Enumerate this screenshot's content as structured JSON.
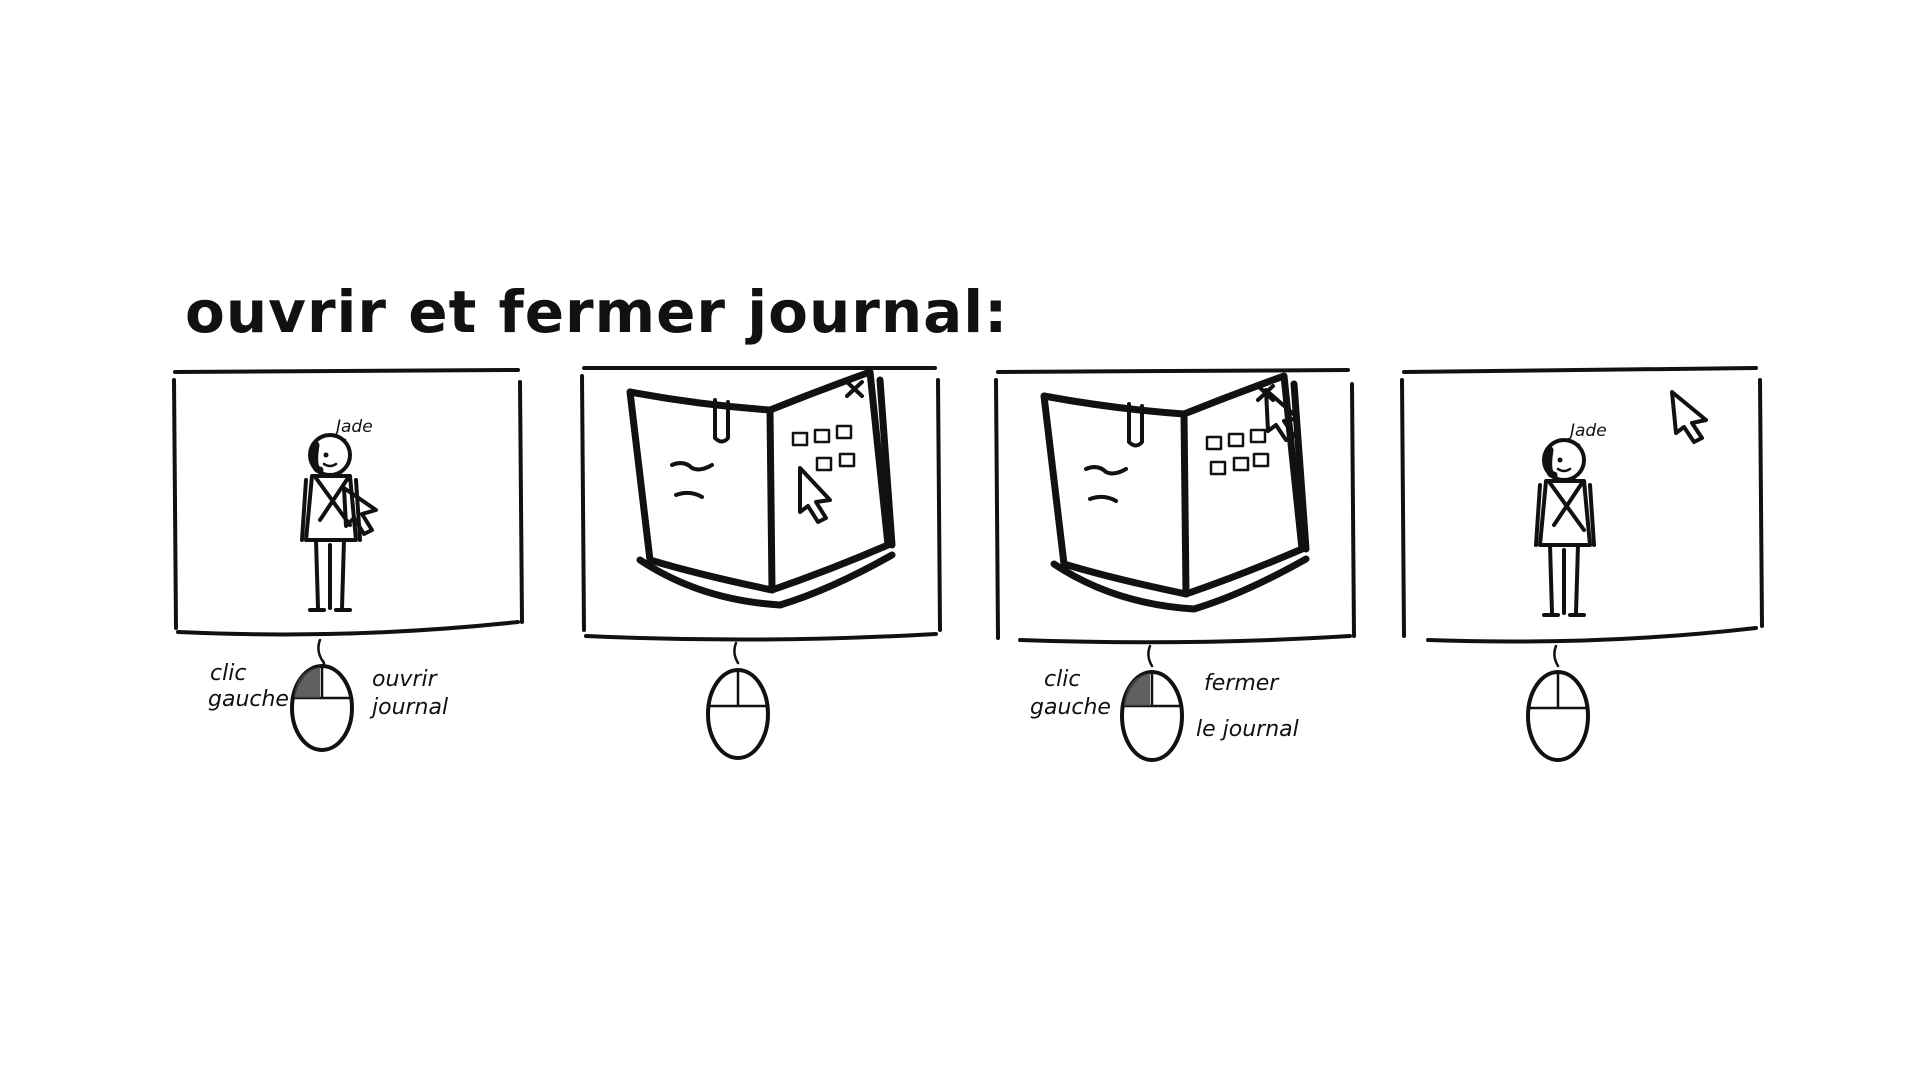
{
  "title": "ouvrir et fermer journal:",
  "panels": [
    {
      "character_name": "Jade",
      "mouse": {
        "left_label": "clic gauche",
        "right_label": "ouvrir journal",
        "left_button_pressed": true
      }
    },
    {
      "mouse": {
        "left_button_pressed": false
      }
    },
    {
      "mouse": {
        "left_label": "clic gauche",
        "right_label": "fermer le journal",
        "left_button_pressed": true
      }
    },
    {
      "character_name": "Jade",
      "mouse": {
        "left_button_pressed": false
      }
    }
  ],
  "icons": {
    "cursor": "arrow-cursor-icon",
    "close": "close-x-icon",
    "mouse": "computer-mouse-icon"
  }
}
